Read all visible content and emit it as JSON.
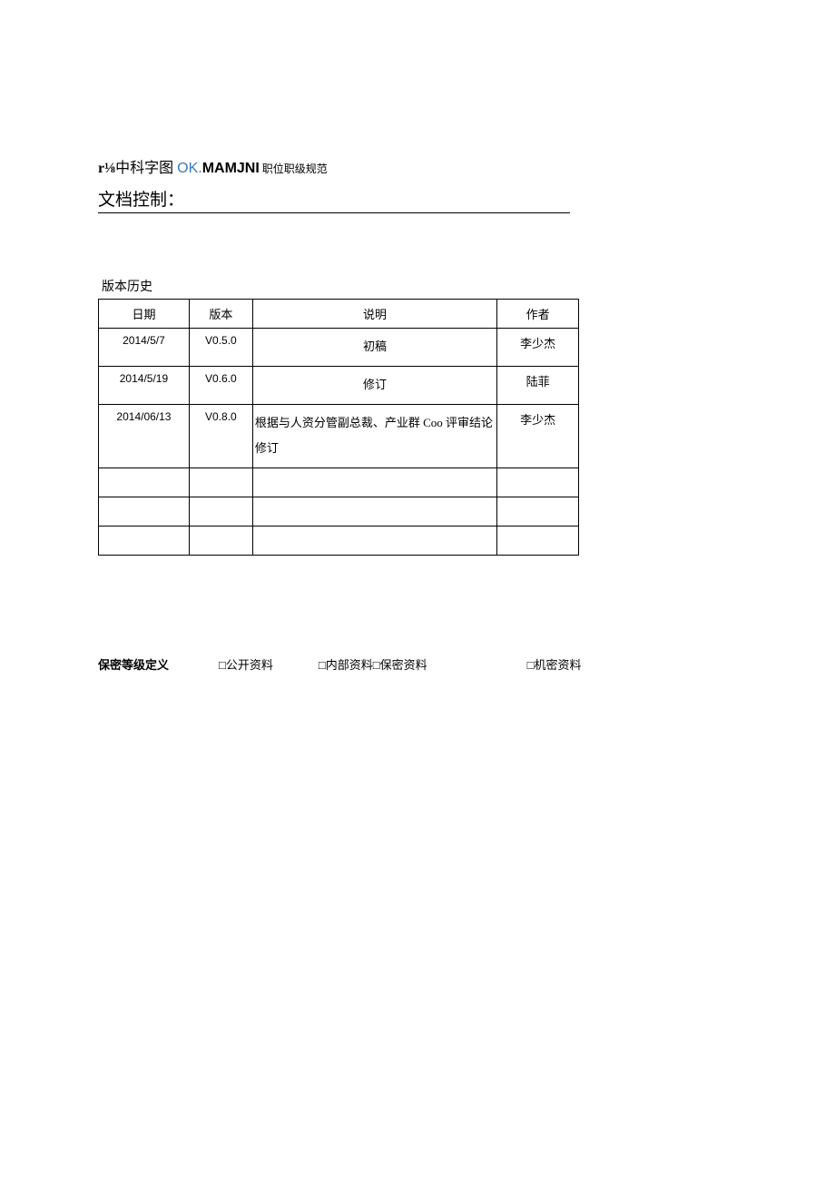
{
  "header": {
    "fraction_prefix": "r⅛",
    "cn1": "中科字图 ",
    "ok": "OK.",
    "mamjni": "MAMJNI",
    "suffix": " 职位职级规范"
  },
  "doc_control": "文档控制：",
  "version_history_label": "版本历史",
  "table": {
    "headers": {
      "date": "日期",
      "version": "版本",
      "desc": "说明",
      "author": "作者"
    },
    "rows": [
      {
        "date": "2014/5/7",
        "version": "V0.5.0",
        "desc": "初稿",
        "desc_center": true,
        "author": "李少杰"
      },
      {
        "date": "2014/5/19",
        "version": "V0.6.0",
        "desc": "修订",
        "desc_center": true,
        "author": "陆菲"
      },
      {
        "date": "2014/06/13",
        "version": "V0.8.0",
        "desc": "根据与人资分管副总裁、产业群 Coo 评审结论修订",
        "desc_center": false,
        "author": "李少杰"
      }
    ]
  },
  "confidentiality": {
    "label": "保密等级定义",
    "checkbox": "□",
    "opt_public": "公开资料",
    "opt_internal": "内部资料",
    "opt_confidential": "保密资料",
    "opt_secret": "机密资料"
  }
}
